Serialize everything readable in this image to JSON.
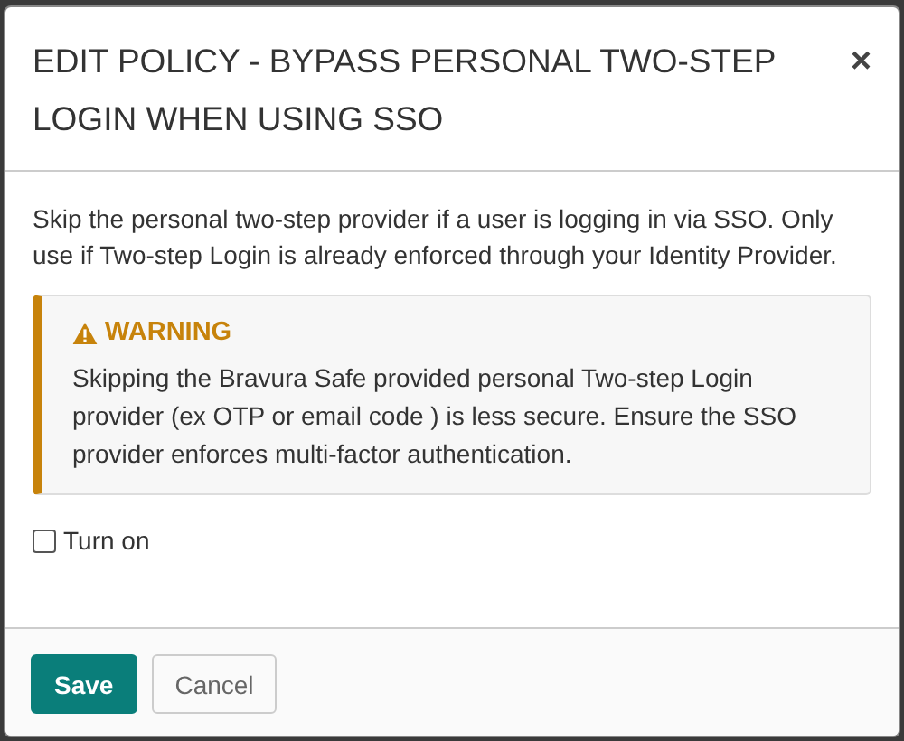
{
  "dialog": {
    "title": "EDIT POLICY - BYPASS PERSONAL TWO-STEP LOGIN WHEN USING SSO",
    "close": "×"
  },
  "description": "Skip the personal two-step provider if a user is logging in via SSO. Only use if Two-step Login is already enforced through your Identity Provider.",
  "warning": {
    "title": "WARNING",
    "text": "Skipping the Bravura Safe provided personal Two-step Login provider (ex OTP or email code ) is less secure. Ensure the SSO provider enforces multi-factor authentication."
  },
  "turn_on": {
    "label": "Turn on",
    "checked": false
  },
  "buttons": [
    {
      "label": "Save",
      "kind": "primary"
    },
    {
      "label": "Cancel",
      "kind": "secondary"
    }
  ]
}
